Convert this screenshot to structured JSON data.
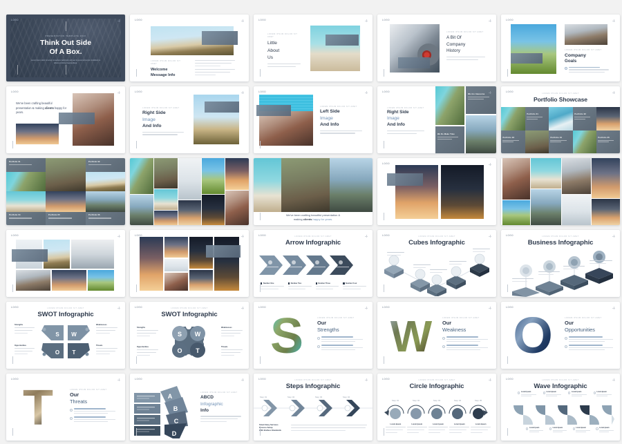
{
  "page": {
    "background": "#f2f2f2",
    "title": "Presentation Template Slide Preview Grid",
    "columns": 5,
    "rows": 6
  },
  "palette": {
    "dark_navy": "#3e4a5c",
    "title_text": "#2f3b4d",
    "accent_blue": "#6f90b5",
    "muted_gray": "#b6bec8",
    "slide_bg": "#ffffff",
    "teal": "#4fc3d6"
  },
  "slides": [
    {
      "id": "s01",
      "mark": "LOGO",
      "kind": "cover",
      "eyebrow": "PRESENTATION TEMPLATE 2019",
      "title_line1": "Think Out Side",
      "title_line2": "Of A Box.",
      "subtitle": "Lorem ipsum dolor sit amet consectetur adipiscing elit sed do eiusmod tempor incididunt ut labore et dolore magna aliqua."
    },
    {
      "id": "s02",
      "mark": "LOGO",
      "kind": "image-top-text-bottom",
      "eyebrow": "LOREM IPSUM DOLOR SIT AMET",
      "title_line1": "Welcome",
      "title_line2": "Message Info",
      "body": "Lorem ipsum dolor sit amet consectetur adipiscing elit sed do eiusmod tempor incididunt ut labore et dolore magna aliqua ut enim ad minim veniam."
    },
    {
      "id": "s03",
      "mark": "LOGO",
      "kind": "left-text-right-image",
      "eyebrow": "LOREM IPSUM DOLOR SIT AMET",
      "title_line1": "Little",
      "title_line2": "About",
      "title_line3": "Us",
      "body": "Lorem ipsum dolor sit amet consectetur adipiscing elit sed do eiusmod tempor."
    },
    {
      "id": "s04",
      "mark": "LOGO",
      "kind": "left-image-right-text",
      "eyebrow": "LOREM IPSUM DOLOR SIT AMET",
      "title_line1": "A Bit Of",
      "title_line2": "Company",
      "title_line3": "History",
      "body": "Lorem ipsum dolor sit amet consectetur adipiscing elit sed do eiusmod tempor."
    },
    {
      "id": "s05",
      "mark": "LOGO",
      "kind": "company-goals",
      "eyebrow": "LOREM IPSUM DOLOR SIT AMET",
      "title_line1": "Company",
      "title_line2": "Goals",
      "body": "Lorem ipsum dolor sit amet consectetur adipiscing elit sed do eiusmod tempor incididunt."
    },
    {
      "id": "s06",
      "mark": "LOGO",
      "kind": "quote-images",
      "quote_a": "We've been crafting beautiful",
      "quote_b": "presentation & making ",
      "quote_highlight": "clients",
      "quote_c": "happy for years."
    },
    {
      "id": "s07",
      "mark": "LOGO",
      "kind": "left-text-right-image",
      "eyebrow": "LOREM IPSUM DOLOR SIT AMET",
      "title_line1": "Right Side",
      "title_line2": "Image",
      "title_line3": "And Info",
      "body": "Lorem ipsum dolor sit amet consectetur adipiscing elit sed do."
    },
    {
      "id": "s08",
      "mark": "LOGO",
      "kind": "left-image-right-text",
      "eyebrow": "LOREM IPSUM DOLOR SIT AMET",
      "title_line1": "Left Side",
      "title_line2": "Image",
      "title_line3": "And Info",
      "body": "Lorem ipsum dolor sit amet consectetur adipiscing elit sed do."
    },
    {
      "id": "s09",
      "mark": "LOGO",
      "kind": "text-left-mosaic-right",
      "eyebrow": "LOREM IPSUM DOLOR SIT AMET",
      "title_line1": "Right Side",
      "title_line2": "Image",
      "title_line3": "And Info",
      "body": "Lorem ipsum dolor sit amet consectetur adipiscing elit.",
      "tiles": [
        {
          "label": "We Are Awesome",
          "sub": "Lorem ipsum dolor sit amet elit"
        },
        {
          "label": "We Do Make Time",
          "sub": "Lorem ipsum dolor sit amet elit"
        }
      ]
    },
    {
      "id": "s10",
      "mark": "LOGO",
      "kind": "portfolio",
      "eyebrow": "LOREM IPSUM DOLOR SIT AMET",
      "title": "Portfolio Showcase",
      "tiles": [
        {
          "label": "Portfolio 01",
          "sub": "Lorem ipsum dolor"
        },
        {
          "label": "Portfolio 02",
          "sub": "Lorem ipsum dolor"
        },
        {
          "label": "Portfolio 03",
          "sub": "Lorem ipsum dolor"
        },
        {
          "label": "Portfolio 04",
          "sub": "Lorem ipsum dolor"
        },
        {
          "label": "Portfolio 05",
          "sub": "Lorem ipsum dolor"
        }
      ]
    },
    {
      "id": "s11",
      "mark": "LOGO",
      "kind": "mosaic-a",
      "tiles": [
        {
          "label": "Portfolio 01",
          "sub": "Lorem ipsum"
        },
        {
          "label": "Portfolio 02",
          "sub": "Lorem ipsum"
        },
        {
          "label": "Portfolio 03",
          "sub": "Lorem ipsum"
        },
        {
          "label": "Portfolio 04",
          "sub": "Lorem ipsum"
        },
        {
          "label": "Portfolio 05",
          "sub": "Lorem ipsum"
        },
        {
          "label": "Portfolio 06",
          "sub": "Lorem ipsum"
        }
      ]
    },
    {
      "id": "s12",
      "mark": "LOGO",
      "kind": "mosaic-b"
    },
    {
      "id": "s13",
      "mark": "LOGO",
      "kind": "quote-full",
      "quote_a": "We've been crafting beautiful presentation &",
      "quote_b": "making ",
      "quote_highlight": "clients",
      "quote_c": " happy for years."
    },
    {
      "id": "s14",
      "mark": "LOGO",
      "kind": "two-photo"
    },
    {
      "id": "s15",
      "mark": "LOGO",
      "kind": "mosaic-c"
    },
    {
      "id": "s16",
      "mark": "LOGO",
      "kind": "mosaic-d"
    },
    {
      "id": "s17",
      "mark": "LOGO",
      "kind": "mosaic-e"
    },
    {
      "id": "s18",
      "mark": "LOGO",
      "kind": "arrow-infographic",
      "eyebrow": "LOREM IPSUM DOLOR SIT AMET",
      "title": "Arrow Infographic",
      "items": [
        {
          "label": "Number One",
          "sub": "Lorem ipsum dolor sit amet consectetur"
        },
        {
          "label": "Number Two",
          "sub": "Lorem ipsum dolor sit amet consectetur"
        },
        {
          "label": "Number Three",
          "sub": "Lorem ipsum dolor sit amet consectetur"
        },
        {
          "label": "Number Four",
          "sub": "Lorem ipsum dolor sit amet consectetur"
        }
      ]
    },
    {
      "id": "s19",
      "mark": "LOGO",
      "kind": "cubes-infographic",
      "eyebrow": "LOREM IPSUM DOLOR SIT AMET",
      "title": "Cubes Infographic",
      "items": [
        {
          "label": "Lorem Ipsum Dolor",
          "sub": "Sit amet consectetur"
        },
        {
          "label": "Lorem Ipsum Dolor",
          "sub": "Sit amet consectetur"
        },
        {
          "label": "Lorem Ipsum Dolor",
          "sub": "Sit amet consectetur"
        },
        {
          "label": "Lorem Ipsum Dolor",
          "sub": "Sit amet consectetur"
        },
        {
          "label": "Lorem Ipsum Dolor",
          "sub": "Sit amet consectetur"
        }
      ]
    },
    {
      "id": "s20",
      "mark": "LOGO",
      "kind": "business-infographic",
      "eyebrow": "LOREM IPSUM DOLOR SIT AMET",
      "title": "Business Infographic",
      "items": [
        {
          "label": "Lorem ipsum dolor sit",
          "sub": "Consectetur elit"
        },
        {
          "label": "Lorem ipsum dolor sit",
          "sub": "Consectetur elit"
        },
        {
          "label": "Lorem ipsum dolor sit",
          "sub": "Consectetur elit"
        },
        {
          "label": "Lorem ipsum dolor sit",
          "sub": "Consectetur elit"
        }
      ]
    },
    {
      "id": "s21",
      "mark": "LOGO",
      "kind": "swot-hex",
      "eyebrow": "LOREM IPSUM DOLOR SIT AMET",
      "title": "SWOT Infographic",
      "letters": [
        "S",
        "W",
        "O",
        "T"
      ],
      "quadrants": [
        {
          "label": "Strengths",
          "sub": "Lorem ipsum dolor sit amet consectetur adipiscing elit"
        },
        {
          "label": "Weaknesses",
          "sub": "Lorem ipsum dolor sit amet consectetur adipiscing elit"
        },
        {
          "label": "Opportunities",
          "sub": "Lorem ipsum dolor sit amet consectetur adipiscing elit"
        },
        {
          "label": "Threats",
          "sub": "Lorem ipsum dolor sit amet consectetur adipiscing elit"
        }
      ]
    },
    {
      "id": "s22",
      "mark": "LOGO",
      "kind": "swot-circle",
      "eyebrow": "LOREM IPSUM DOLOR SIT AMET",
      "title": "SWOT Infographic",
      "letters": [
        "S",
        "W",
        "O",
        "T"
      ],
      "quadrants": [
        {
          "label": "Strengths",
          "sub": "Lorem ipsum dolor sit amet consectetur adipiscing elit"
        },
        {
          "label": "Weaknesses",
          "sub": "Lorem ipsum dolor sit amet consectetur adipiscing elit"
        },
        {
          "label": "Opportunities",
          "sub": "Lorem ipsum dolor sit amet consectetur adipiscing elit"
        },
        {
          "label": "Threats",
          "sub": "Lorem ipsum dolor sit amet consectetur adipiscing elit"
        }
      ]
    },
    {
      "id": "s23",
      "mark": "LOGO",
      "kind": "letter-s",
      "letter": "S",
      "eyebrow": "LOREM IPSUM DOLOR SIT AMET",
      "title_line1": "Our",
      "title_line2": "Strengths",
      "bullets": [
        {
          "label": "Lorem ipsum dolor sit amet elit",
          "sub": "Lorem ipsum dolor sit amet consectetur adipiscing elit sed"
        },
        {
          "label": "Lorem ipsum dolor sit amet elit",
          "sub": "Lorem ipsum dolor sit amet consectetur adipiscing elit sed"
        }
      ]
    },
    {
      "id": "s24",
      "mark": "LOGO",
      "kind": "letter-w",
      "letter": "W",
      "eyebrow": "LOREM IPSUM DOLOR SIT AMET",
      "title_line1": "Our",
      "title_line2": "Weakness",
      "bullets": [
        {
          "label": "Lorem ipsum dolor sit amet elit",
          "sub": "Lorem ipsum dolor sit amet consectetur adipiscing elit sed"
        },
        {
          "label": "Lorem ipsum dolor sit amet elit",
          "sub": "Lorem ipsum dolor sit amet consectetur adipiscing elit sed"
        }
      ]
    },
    {
      "id": "s25",
      "mark": "LOGO",
      "kind": "letter-o",
      "letter": "O",
      "eyebrow": "LOREM IPSUM DOLOR SIT AMET",
      "title_line1": "Our",
      "title_line2": "Opportunities",
      "bullets": [
        {
          "label": "Lorem ipsum dolor sit amet elit",
          "sub": "Lorem ipsum dolor sit amet consectetur adipiscing elit sed"
        },
        {
          "label": "Lorem ipsum dolor sit amet elit",
          "sub": "Lorem ipsum dolor sit amet consectetur adipiscing elit sed"
        }
      ]
    },
    {
      "id": "s26",
      "mark": "LOGO",
      "kind": "letter-t",
      "letter": "T",
      "eyebrow": "LOREM IPSUM DOLOR SIT AMET",
      "title_line1": "Our",
      "title_line2": "Threats",
      "bullets": [
        {
          "label": "Lorem ipsum dolor sit amet elit",
          "sub": "Lorem ipsum dolor sit amet consectetur adipiscing elit sed"
        },
        {
          "label": "Lorem ipsum dolor sit amet elit",
          "sub": "Lorem ipsum dolor sit amet consectetur adipiscing elit sed"
        }
      ]
    },
    {
      "id": "s27",
      "mark": "LOGO",
      "kind": "abcd-infographic",
      "eyebrow": "LOREM IPSUM DOLOR SIT AMET",
      "title_line1": "ABCD",
      "title_line2": "Infographic",
      "title_line3": "Info",
      "body": "Lorem ipsum dolor sit amet consectetur adipiscing elit sed do eiusmod tempor.",
      "letters": [
        "A",
        "B",
        "C",
        "D"
      ],
      "items": [
        {
          "label": "Lorem Ipsum Dolor",
          "sub": "Sit amet consectetur elit"
        },
        {
          "label": "Lorem Ipsum Dolor",
          "sub": "Sit amet consectetur elit"
        },
        {
          "label": "Lorem Ipsum Dolor",
          "sub": "Sit amet consectetur elit"
        },
        {
          "label": "Lorem Ipsum Dolor",
          "sub": "Sit amet consectetur elit"
        }
      ]
    },
    {
      "id": "s28",
      "mark": "LOGO",
      "kind": "steps-infographic",
      "eyebrow": "LOREM IPSUM DOLOR SIT AMET",
      "title": "Steps Infographic",
      "steps": [
        "Step 01",
        "Step 02",
        "Step 03",
        "Step 04"
      ],
      "footer_title_1": "Smart Easy Services",
      "footer_title_2": "Process Setup",
      "footer_title_3": "With Endless Standards",
      "footer_body": "Lorem ipsum dolor sit amet consectetur adipiscing elit sed do eiusmod tempor incididunt ut labore et dolore magna aliqua ut enim ad minim veniam quis nostrud."
    },
    {
      "id": "s29",
      "mark": "LOGO",
      "kind": "circle-infographic",
      "eyebrow": "LOREM IPSUM DOLOR SIT AMET",
      "title": "Circle Infographic",
      "steps": [
        "Step 01",
        "Step 02",
        "Step 03",
        "Step 04",
        "Step 05"
      ],
      "items": [
        {
          "label": "Lorem Ipsum",
          "sub": "Lorem ipsum dolor sit amet consectetur elit"
        },
        {
          "label": "Lorem Ipsum",
          "sub": "Lorem ipsum dolor sit amet consectetur elit"
        },
        {
          "label": "Lorem Ipsum",
          "sub": "Lorem ipsum dolor sit amet consectetur elit"
        },
        {
          "label": "Lorem Ipsum",
          "sub": "Lorem ipsum dolor sit amet consectetur elit"
        },
        {
          "label": "Lorem Ipsum",
          "sub": "Lorem ipsum dolor sit amet consectetur elit"
        }
      ]
    },
    {
      "id": "s30",
      "mark": "LOGO",
      "kind": "wave-infographic",
      "eyebrow": "LOREM IPSUM DOLOR SIT AMET",
      "title": "Wave Infographic",
      "top_items": [
        {
          "label": "Lorem Ipsum",
          "sub": "Dolor sit amet"
        },
        {
          "label": "Lorem Ipsum",
          "sub": "Dolor sit amet"
        },
        {
          "label": "Lorem Ipsum",
          "sub": "Dolor sit amet"
        },
        {
          "label": "Lorem Ipsum",
          "sub": "Dolor sit amet"
        }
      ],
      "bottom_items": [
        {
          "label": "Lorem Ipsum",
          "sub": "Dolor sit amet"
        },
        {
          "label": "Lorem Ipsum",
          "sub": "Dolor sit amet"
        },
        {
          "label": "Lorem Ipsum",
          "sub": "Dolor sit amet"
        },
        {
          "label": "Lorem Ipsum",
          "sub": "Dolor sit amet"
        }
      ]
    }
  ]
}
